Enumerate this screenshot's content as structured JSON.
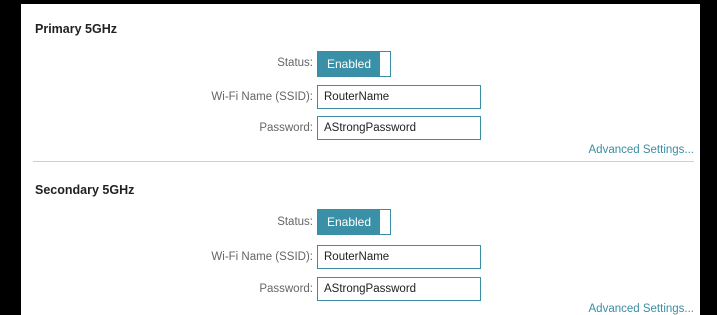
{
  "sections": [
    {
      "title": "Primary 5GHz",
      "status_label": "Status:",
      "status_value": "Enabled",
      "ssid_label": "Wi-Fi Name (SSID):",
      "ssid_value": "RouterName",
      "password_label": "Password:",
      "password_value": "AStrongPassword",
      "advanced_link": "Advanced Settings..."
    },
    {
      "title": "Secondary 5GHz",
      "status_label": "Status:",
      "status_value": "Enabled",
      "ssid_label": "Wi-Fi Name (SSID):",
      "ssid_value": "RouterName",
      "password_label": "Password:",
      "password_value": "AStrongPassword",
      "advanced_link": "Advanced Settings..."
    }
  ],
  "colors": {
    "accent": "#3a90a6",
    "frame": "#000000"
  }
}
